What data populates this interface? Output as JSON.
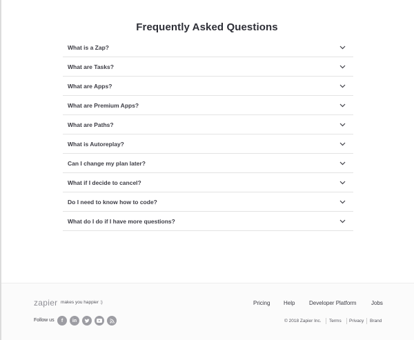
{
  "page": {
    "title": "Frequently Asked Questions"
  },
  "faq": [
    {
      "question": "What is a Zap?"
    },
    {
      "question": "What are Tasks?"
    },
    {
      "question": "What are Apps?"
    },
    {
      "question": "What are Premium Apps?"
    },
    {
      "question": "What are Paths?"
    },
    {
      "question": "What is Autoreplay?"
    },
    {
      "question": "Can I change my plan later?"
    },
    {
      "question": "What if I decide to cancel?"
    },
    {
      "question": "Do I need to know how to code?"
    },
    {
      "question": "What do I do if I have more questions?"
    }
  ],
  "footer": {
    "logo": "zapier",
    "tagline": "makes you happier :)",
    "nav": [
      "Pricing",
      "Help",
      "Developer Platform",
      "Jobs"
    ],
    "follow_label": "Follow us",
    "social_icons": [
      "facebook-icon",
      "linkedin-icon",
      "twitter-icon",
      "youtube-icon",
      "rss-icon"
    ],
    "copyright": "© 2018 Zapier Inc.",
    "legal_links": [
      "Terms",
      "Privacy",
      "Brand"
    ]
  },
  "colors": {
    "text": "#2d2e36",
    "divider": "#e3e3e3",
    "social": "#9d9da3"
  }
}
